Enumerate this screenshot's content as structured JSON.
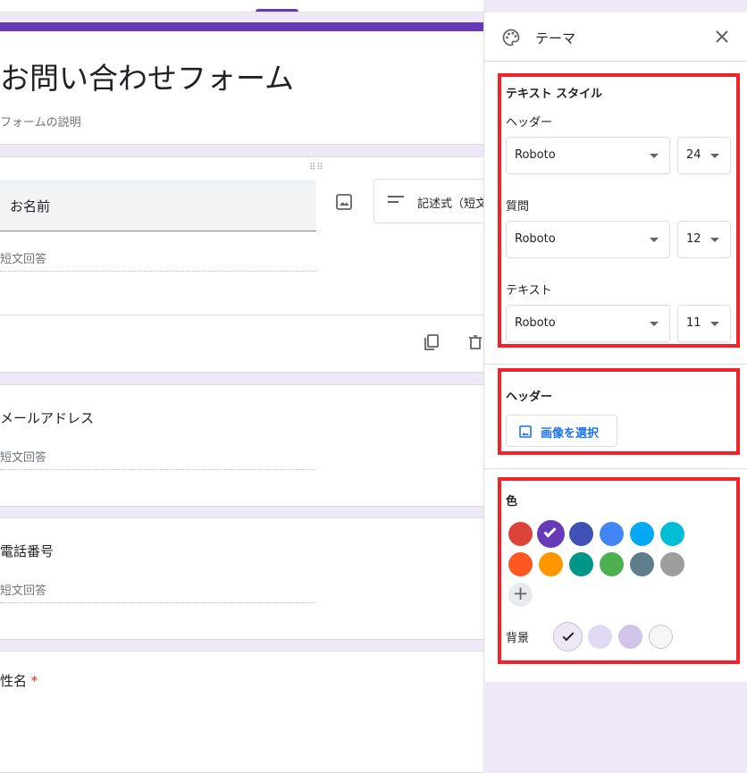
{
  "colors": {
    "accent": "#673ab7",
    "highlight_box": "#f0222a"
  },
  "form": {
    "title": "お問い合わせフォーム",
    "description": "フォームの説明",
    "questions": [
      {
        "label": "お名前",
        "type_label": "記述式（短文",
        "answer_placeholder": "短文回答"
      },
      {
        "label": "メールアドレス",
        "answer_placeholder": "短文回答"
      },
      {
        "label": "電話番号",
        "answer_placeholder": "短文回答"
      },
      {
        "label": "性名",
        "required_mark": "*"
      }
    ]
  },
  "theme_panel": {
    "title": "テーマ",
    "text_style": {
      "heading": "テキスト スタイル",
      "rows": [
        {
          "label": "ヘッダー",
          "font": "Roboto",
          "size": "24"
        },
        {
          "label": "質問",
          "font": "Roboto",
          "size": "12"
        },
        {
          "label": "テキスト",
          "font": "Roboto",
          "size": "11"
        }
      ]
    },
    "header": {
      "heading": "ヘッダー",
      "select_image_label": "画像を選択"
    },
    "color": {
      "heading": "色",
      "swatches": [
        "#db4437",
        "#673ab7",
        "#3f51b5",
        "#4285f4",
        "#03a9f4",
        "#00bcd4",
        "#ff5722",
        "#ff9800",
        "#009688",
        "#4caf50",
        "#607d8b",
        "#9e9e9e"
      ],
      "selected_index": 1,
      "add_symbol": "+",
      "background_label": "背景",
      "backgrounds": [
        "#ede7f6",
        "#e1d9f1",
        "#d1c4e9",
        "#f6f6f6"
      ],
      "background_selected_index": 0
    }
  }
}
